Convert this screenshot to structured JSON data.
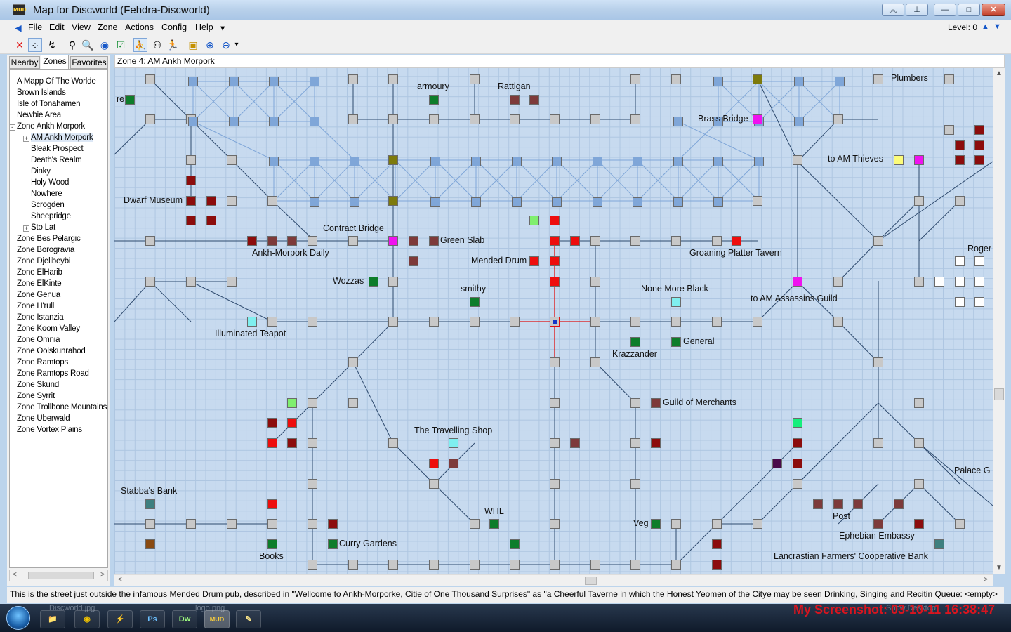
{
  "window": {
    "title": "Map for Discworld (Fehdra-Discworld)",
    "app_icon": "MUD",
    "controls": {
      "collapse": "︽",
      "pin": "⊥",
      "minimize": "—",
      "maximize": "□",
      "close": "✕"
    }
  },
  "menu": {
    "items": [
      "File",
      "Edit",
      "View",
      "Zone",
      "Actions",
      "Config",
      "Help"
    ],
    "more": "▾",
    "back": "◀"
  },
  "level": {
    "label": "Level: 0",
    "up": "▲",
    "down": "▼"
  },
  "toolbar": {
    "icons": [
      "delete-icon",
      "connect-icon",
      "walk-icon",
      "binoculars-icon",
      "find-icon",
      "globe-icon",
      "checkbox-icon",
      "person-icon",
      "people-icon",
      "runner-icon",
      "zone-icon",
      "zoom-in-icon",
      "zoom-out-icon"
    ],
    "glyphs": [
      "✕",
      "⁘",
      "↯",
      "⚲",
      "🔍",
      "◉",
      "☑",
      "⛹",
      "⚇",
      "🏃",
      "▣",
      "⊕",
      "⊖"
    ],
    "dropdown": "▾"
  },
  "sidebar": {
    "tabs": [
      "Nearby",
      "Zones",
      "Favorites"
    ],
    "active_tab": "Zones",
    "tree": [
      {
        "label": "A Mapp Of The Worlde",
        "level": 0,
        "expander": ""
      },
      {
        "label": "Brown Islands",
        "level": 0,
        "expander": ""
      },
      {
        "label": "Isle of Tonahamen",
        "level": 0,
        "expander": ""
      },
      {
        "label": "Newbie Area",
        "level": 0,
        "expander": ""
      },
      {
        "label": "Zone Ankh Morpork",
        "level": 0,
        "expander": "-"
      },
      {
        "label": "AM Ankh Morpork",
        "level": 1,
        "expander": "+",
        "selected": true
      },
      {
        "label": "Bleak Prospect",
        "level": 1,
        "expander": ""
      },
      {
        "label": "Death's Realm",
        "level": 1,
        "expander": ""
      },
      {
        "label": "Dinky",
        "level": 1,
        "expander": ""
      },
      {
        "label": "Holy Wood",
        "level": 1,
        "expander": ""
      },
      {
        "label": "Nowhere",
        "level": 1,
        "expander": ""
      },
      {
        "label": "Scrogden",
        "level": 1,
        "expander": ""
      },
      {
        "label": "Sheepridge",
        "level": 1,
        "expander": ""
      },
      {
        "label": "Sto Lat",
        "level": 1,
        "expander": "+"
      },
      {
        "label": "Zone Bes Pelargic",
        "level": 0,
        "expander": ""
      },
      {
        "label": "Zone Borogravia",
        "level": 0,
        "expander": ""
      },
      {
        "label": "Zone Djelibeybi",
        "level": 0,
        "expander": ""
      },
      {
        "label": "Zone ElHarib",
        "level": 0,
        "expander": ""
      },
      {
        "label": "Zone ElKinte",
        "level": 0,
        "expander": ""
      },
      {
        "label": "Zone Genua",
        "level": 0,
        "expander": ""
      },
      {
        "label": "Zone H'rull",
        "level": 0,
        "expander": ""
      },
      {
        "label": "Zone Istanzia",
        "level": 0,
        "expander": ""
      },
      {
        "label": "Zone Koom Valley",
        "level": 0,
        "expander": ""
      },
      {
        "label": "Zone Omnia",
        "level": 0,
        "expander": ""
      },
      {
        "label": "Zone Oolskunrahod",
        "level": 0,
        "expander": ""
      },
      {
        "label": "Zone Ramtops",
        "level": 0,
        "expander": ""
      },
      {
        "label": "Zone Ramtops Road",
        "level": 0,
        "expander": ""
      },
      {
        "label": "Zone Skund",
        "level": 0,
        "expander": ""
      },
      {
        "label": "Zone Syrrit",
        "level": 0,
        "expander": ""
      },
      {
        "label": "Zone Trollbone Mountains",
        "level": 0,
        "expander": ""
      },
      {
        "label": "Zone Uberwald",
        "level": 0,
        "expander": ""
      },
      {
        "label": "Zone Vortex Plains",
        "level": 0,
        "expander": ""
      }
    ],
    "scroll_left": "<",
    "scroll_right": ">"
  },
  "map": {
    "header": "Zone 4: AM Ankh Morpork",
    "colors": {
      "room": "#c8c8c8",
      "shop": "#0d7d2a",
      "red": "#ee0d0d",
      "darkred": "#8c0c0c",
      "brown": "#7d3a3a",
      "magenta": "#ef12ef",
      "olive": "#7d7a0c",
      "lightgreen": "#7fef6f",
      "cyan": "#7fefef",
      "yellow": "#fcfc7a",
      "white": "#ffffff",
      "teal": "#3d7f7f",
      "orange": "#8a4a10",
      "purple": "#4a0a4a",
      "mint": "#15ef7d",
      "bridge": "#7fa6d8",
      "path": "#2e4a6e",
      "current": "#e01010"
    },
    "labels": [
      "re",
      "armoury",
      "Rattigan",
      "Plumbers",
      "Brass Bridge",
      "to AM Thieves",
      "Dwarf Museum",
      "Contract Bridge",
      "Green Slab",
      "Ankh-Morpork Daily",
      "Mended Drum",
      "Groaning Platter Tavern",
      "Roger",
      "Wozzas",
      "smithy",
      "None More Black",
      "to AM Assassins Guild",
      "Illuminated Teapot",
      "Krazzander",
      "General",
      "Guild of Merchants",
      "The Travelling Shop",
      "Palace G",
      "Stabba's Bank",
      "WHL",
      "Veg",
      "Post",
      "Ephebian Embassy",
      "Curry Gardens",
      "Books",
      "Lancrastian Farmers' Cooperative Bank"
    ],
    "scroll": {
      "up": "▲",
      "down": "▼",
      "left": "<",
      "right": ">"
    }
  },
  "status": {
    "text": "This is the street just outside the infamous Mended Drum pub, described in \"Wellcome to Ankh-Morporke, Citie of One Thousand Surprises\" as \"a Cheerful Taverne in which the Honest Yeomen of the Citye may be seen Drinking, Singing and Recitin Queue: <empty>"
  },
  "taskbar": {
    "ghost_tabs": [
      "Discworld.jpg",
      "logo.png",
      "Show Desktop"
    ],
    "apps": [
      {
        "name": "explorer",
        "glyph": "📁"
      },
      {
        "name": "chrome",
        "glyph": "◉"
      },
      {
        "name": "winamp",
        "glyph": "⚡"
      },
      {
        "name": "photoshop",
        "glyph": "Ps"
      },
      {
        "name": "dreamweaver",
        "glyph": "Dw"
      },
      {
        "name": "mudlet",
        "glyph": "MUD"
      },
      {
        "name": "notepad",
        "glyph": "✎"
      }
    ],
    "watermark": "My Screenshot: 03-10-11 16:38:47"
  }
}
